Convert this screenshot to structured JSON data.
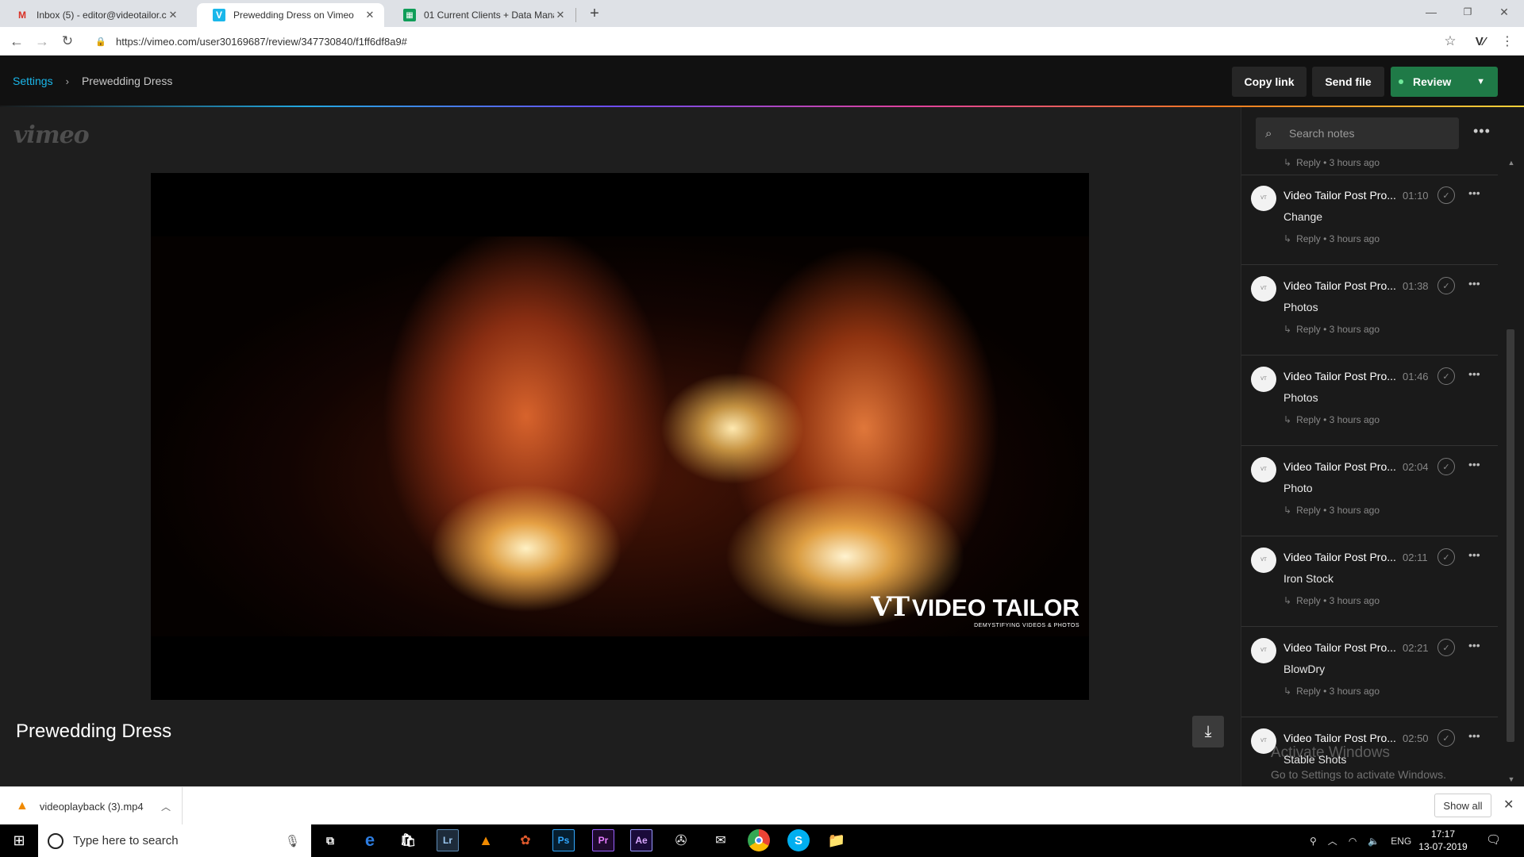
{
  "browser": {
    "tabs": [
      {
        "title": "Inbox (5) - editor@videotailor.co",
        "icon": "gmail-icon",
        "active": false
      },
      {
        "title": "Prewedding Dress on Vimeo",
        "icon": "vimeo-icon",
        "active": true
      },
      {
        "title": "01 Current Clients + Data Manag",
        "icon": "sheets-icon",
        "active": false
      }
    ],
    "new_tab": "+",
    "url": "https://vimeo.com/user30169687/review/347730840/f1ff6df8a9#"
  },
  "header": {
    "breadcrumb_root": "Settings",
    "breadcrumb_current": "Prewedding Dress",
    "copy_link": "Copy link",
    "send_file": "Send file",
    "review": "Review",
    "accent": "#1ab7ea",
    "review_color": "#1f7a47"
  },
  "player": {
    "logo": "vimeo",
    "video_title": "Prewedding Dress",
    "watermark_mark": "VT",
    "watermark_name": "VIDEO TAILOR",
    "watermark_tagline": "DEMYSTIFYING VIDEOS & PHOTOS"
  },
  "notes": {
    "search_placeholder": "Search notes",
    "partial_reply": "Reply • 3 hours ago",
    "items": [
      {
        "author": "Video Tailor Post Pro...",
        "time": "01:10",
        "body": "Change",
        "meta": "Reply • 3 hours ago"
      },
      {
        "author": "Video Tailor Post Pro...",
        "time": "01:38",
        "body": "Photos",
        "meta": "Reply • 3 hours ago"
      },
      {
        "author": "Video Tailor Post Pro...",
        "time": "01:46",
        "body": "Photos",
        "meta": "Reply • 3 hours ago"
      },
      {
        "author": "Video Tailor Post Pro...",
        "time": "02:04",
        "body": "Photo",
        "meta": "Reply • 3 hours ago"
      },
      {
        "author": "Video Tailor Post Pro...",
        "time": "02:11",
        "body": "Iron Stock",
        "meta": "Reply • 3 hours ago"
      },
      {
        "author": "Video Tailor Post Pro...",
        "time": "02:21",
        "body": "BlowDry",
        "meta": "Reply • 3 hours ago"
      },
      {
        "author": "Video Tailor Post Pro...",
        "time": "02:50",
        "body": "Stable Shots",
        "meta": ""
      }
    ],
    "activate_title": "Activate Windows",
    "activate_sub": "Go to Settings to activate Windows."
  },
  "download_bar": {
    "file": "videoplayback (3).mp4",
    "show_all": "Show all"
  },
  "taskbar": {
    "search_placeholder": "Type here to search",
    "lang": "ENG",
    "time": "17:17",
    "date": "13-07-2019"
  }
}
